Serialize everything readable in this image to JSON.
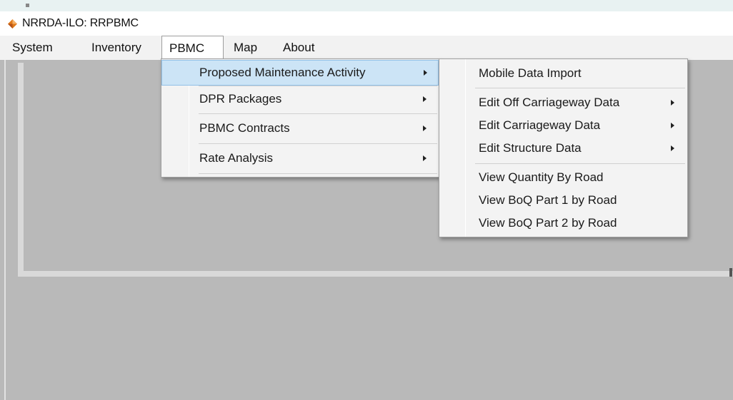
{
  "window": {
    "title": "NRRDA-ILO: RRPBMC",
    "icon": "app-diamond-icon"
  },
  "colors": {
    "menu_highlight": "#cce4f6",
    "content_background": "#b9b9b9",
    "app_icon": "#e07a1a"
  },
  "menubar": {
    "items": [
      {
        "label": "System"
      },
      {
        "label": "Inventory"
      },
      {
        "label": "PBMC",
        "active": true
      },
      {
        "label": "Map"
      },
      {
        "label": "About"
      }
    ]
  },
  "pbmc_menu": {
    "items": [
      {
        "label": "Proposed Maintenance Activity",
        "submenu": true,
        "highlighted": true
      },
      {
        "label": "DPR Packages",
        "submenu": true
      },
      {
        "label": "PBMC Contracts",
        "submenu": true
      },
      {
        "label": "Rate Analysis",
        "submenu": true
      }
    ]
  },
  "maintenance_submenu": {
    "items": [
      {
        "label": "Mobile Data Import",
        "submenu": false
      },
      {
        "label": "Edit Off Carriageway Data",
        "submenu": true
      },
      {
        "label": "Edit Carriageway Data",
        "submenu": true
      },
      {
        "label": "Edit Structure Data",
        "submenu": true
      },
      {
        "label": "View Quantity By Road",
        "submenu": false
      },
      {
        "label": "View BoQ Part 1 by Road",
        "submenu": false
      },
      {
        "label": "View BoQ Part 2 by Road",
        "submenu": false
      }
    ]
  }
}
